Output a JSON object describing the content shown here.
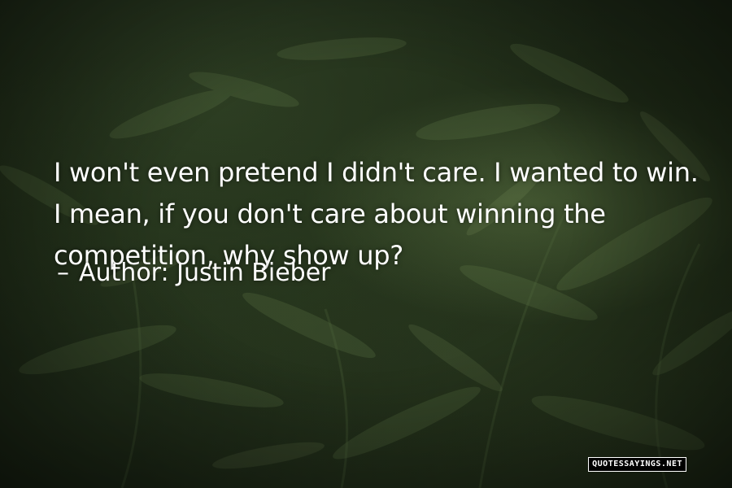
{
  "quote": {
    "text": "I won't even pretend I didn't care. I wanted to win. I mean, if you don't care about winning the competition, why show up?",
    "author_prefix": "Author:",
    "author_name": "Justin Bieber",
    "dash_glyph": "–"
  },
  "background": {
    "description_icon": "fern-foliage",
    "tint": "#1c2716"
  },
  "watermark": {
    "text": "QUOTESSAYINGS.NET"
  }
}
